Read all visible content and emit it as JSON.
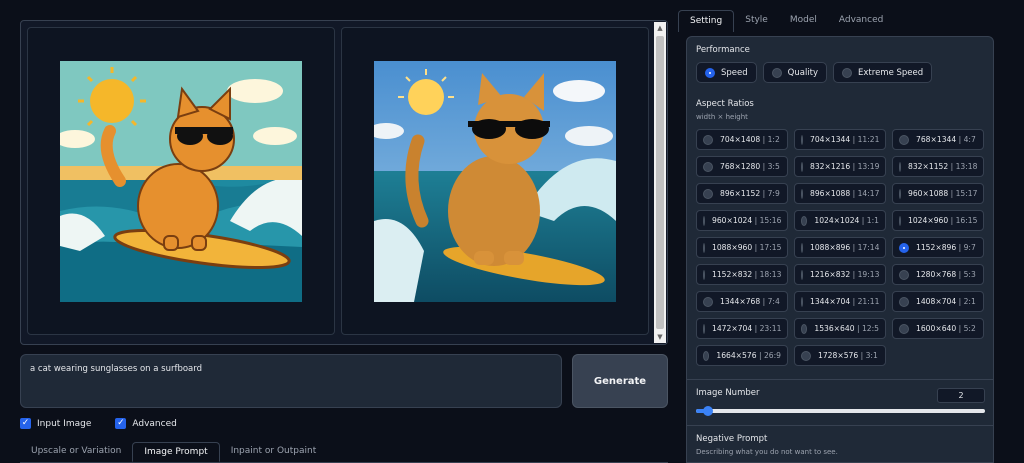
{
  "prompt": {
    "text": "a cat wearing sunglasses on a surfboard"
  },
  "generate_label": "Generate",
  "checkboxes": [
    {
      "label": "Input Image",
      "checked": true
    },
    {
      "label": "Advanced",
      "checked": true
    }
  ],
  "bottom_tabs": [
    "Upscale or Variation",
    "Image Prompt",
    "Inpaint or Outpaint"
  ],
  "bottom_tab_active": "Image Prompt",
  "right_tabs": [
    "Setting",
    "Style",
    "Model",
    "Advanced"
  ],
  "right_tab_active": "Setting",
  "performance": {
    "title": "Performance",
    "options": [
      "Speed",
      "Quality",
      "Extreme Speed"
    ],
    "selected": "Speed"
  },
  "aspect": {
    "title": "Aspect Ratios",
    "subtitle": "width × height",
    "selected": "1152×896",
    "options": [
      {
        "size": "704×1408",
        "ratio": "1:2"
      },
      {
        "size": "704×1344",
        "ratio": "11:21"
      },
      {
        "size": "768×1344",
        "ratio": "4:7"
      },
      {
        "size": "768×1280",
        "ratio": "3:5"
      },
      {
        "size": "832×1216",
        "ratio": "13:19"
      },
      {
        "size": "832×1152",
        "ratio": "13:18"
      },
      {
        "size": "896×1152",
        "ratio": "7:9"
      },
      {
        "size": "896×1088",
        "ratio": "14:17"
      },
      {
        "size": "960×1088",
        "ratio": "15:17"
      },
      {
        "size": "960×1024",
        "ratio": "15:16"
      },
      {
        "size": "1024×1024",
        "ratio": "1:1"
      },
      {
        "size": "1024×960",
        "ratio": "16:15"
      },
      {
        "size": "1088×960",
        "ratio": "17:15"
      },
      {
        "size": "1088×896",
        "ratio": "17:14"
      },
      {
        "size": "1152×896",
        "ratio": "9:7"
      },
      {
        "size": "1152×832",
        "ratio": "18:13"
      },
      {
        "size": "1216×832",
        "ratio": "19:13"
      },
      {
        "size": "1280×768",
        "ratio": "5:3"
      },
      {
        "size": "1344×768",
        "ratio": "7:4"
      },
      {
        "size": "1344×704",
        "ratio": "21:11"
      },
      {
        "size": "1408×704",
        "ratio": "2:1"
      },
      {
        "size": "1472×704",
        "ratio": "23:11"
      },
      {
        "size": "1536×640",
        "ratio": "12:5"
      },
      {
        "size": "1600×640",
        "ratio": "5:2"
      },
      {
        "size": "1664×576",
        "ratio": "26:9"
      },
      {
        "size": "1728×576",
        "ratio": "3:1"
      }
    ]
  },
  "image_number": {
    "title": "Image Number",
    "value": "2",
    "slider_fraction": 0.04
  },
  "negative": {
    "title": "Negative Prompt",
    "placeholder": "Describing what you do not want to see."
  },
  "colors": {
    "accent": "#2563eb",
    "panel": "#1f2937",
    "background": "#0b0f19"
  },
  "gallery_images": [
    {
      "name": "cartoon-cat-surfing"
    },
    {
      "name": "photo-cat-surfing"
    }
  ]
}
